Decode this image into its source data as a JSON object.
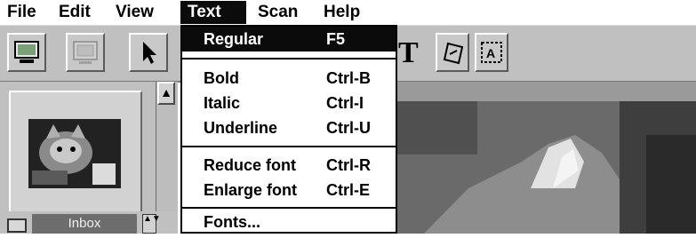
{
  "menubar": {
    "items": [
      {
        "label": "File"
      },
      {
        "label": "Edit"
      },
      {
        "label": "View"
      },
      {
        "label": "Text"
      },
      {
        "label": "Scan"
      },
      {
        "label": "Help"
      }
    ]
  },
  "toolbar": {
    "buttons": [
      {
        "icon": "scanner-icon"
      },
      {
        "icon": "display-icon"
      },
      {
        "icon": "pointer-arrow-icon"
      },
      {
        "icon": "text-tool-icon",
        "glyph": "T"
      },
      {
        "icon": "rotate-page-icon"
      },
      {
        "icon": "ocr-text-icon"
      }
    ]
  },
  "text_menu": {
    "items": [
      {
        "label": "Regular",
        "shortcut": "F5"
      },
      {
        "label": "Bold",
        "shortcut": "Ctrl-B"
      },
      {
        "label": "Italic",
        "shortcut": "Ctrl-I"
      },
      {
        "label": "Underline",
        "shortcut": "Ctrl-U"
      },
      {
        "label": "Reduce font",
        "shortcut": "Ctrl-R"
      },
      {
        "label": "Enlarge font",
        "shortcut": "Ctrl-E"
      },
      {
        "label": "Fonts..."
      }
    ]
  },
  "left_panel": {
    "folder_name": "Inbox",
    "scroll_up_glyph": "▲",
    "spin_glyph": "▲▼"
  },
  "colors": {
    "menu_highlight": "#0b0b0b",
    "toolbar_bg": "#c0c0c0",
    "folder_field": "#6d6d6d"
  }
}
